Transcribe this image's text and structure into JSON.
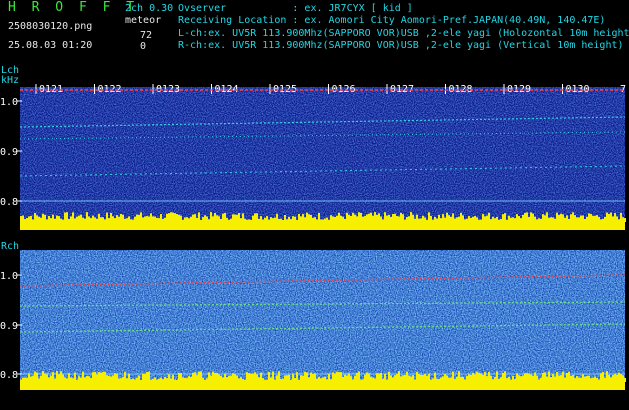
{
  "header": {
    "app_title": "H R O F F T",
    "filename": "2508030120.png",
    "datetime": "25.08.03 01:20",
    "mode": "2ch 0.30",
    "meteor_label": "meteor",
    "count_lch": "72",
    "count_rch": "0",
    "observer": "Ovserver           : ex. JR7CYX [ kid ]",
    "location": "Receiving Location : ex. Aomori City Aomori-Pref.JAPAN(40.49N, 140.47E)",
    "lch_info": "L-ch:ex. UV5R 113.900Mhz(SAPPORO VOR)USB ,2-ele yagi (Holozontal 10m height)",
    "rch_info": "R-ch:ex. UV5R 113.900Mhz(SAPPORO VOR)USB ,2-ele yagi (Vertical 10m height)"
  },
  "lch": {
    "label": "Lch",
    "unit": "kHz",
    "y_ticks": [
      "1.0",
      "0.9",
      "0.8"
    ]
  },
  "rch": {
    "label": "Rch",
    "y_ticks": [
      "1.0",
      "0.9",
      "0.8"
    ]
  },
  "time_labels": [
    "0121",
    "0122",
    "0123",
    "0124",
    "0125",
    "0126",
    "0127",
    "0128",
    "0129",
    "0130"
  ],
  "time_label_tail": "7",
  "colors": {
    "background": "#000000",
    "label_cyan": "#21d7e6",
    "label_white": "#e8e8e8",
    "label_green": "#3be73b",
    "spectrogram_bg": "#0a1a8c",
    "noise_bar": "#f6f000",
    "trace_cyan": "#39e6e6",
    "trace_red": "#ff4040"
  }
}
